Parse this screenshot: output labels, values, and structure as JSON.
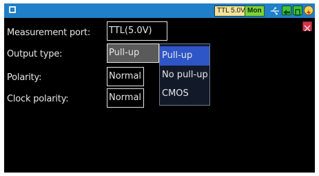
{
  "status_bar": {
    "window_icon": "window-icon",
    "ttl_badge": "TTL 5.0V",
    "mon_badge": "Mon",
    "icons": [
      "usb-icon",
      "arrow-icon",
      "card-icon",
      "power-icon"
    ]
  },
  "settings": [
    {
      "label": "Measurement port:",
      "value": "TTL(5.0V)"
    },
    {
      "label": "Output type:",
      "value": "Pull-up"
    },
    {
      "label": "Polarity:",
      "value": "Normal"
    },
    {
      "label": "Clock polarity:",
      "value": "Normal"
    }
  ],
  "dropdown": {
    "options": [
      "Pull-up",
      "No pull-up",
      "CMOS"
    ],
    "selected": "Pull-up"
  },
  "colors": {
    "status_bar": "#1f7fc8",
    "background": "#000000",
    "selected_option": "#2f56c7",
    "close": "#d1354a"
  }
}
